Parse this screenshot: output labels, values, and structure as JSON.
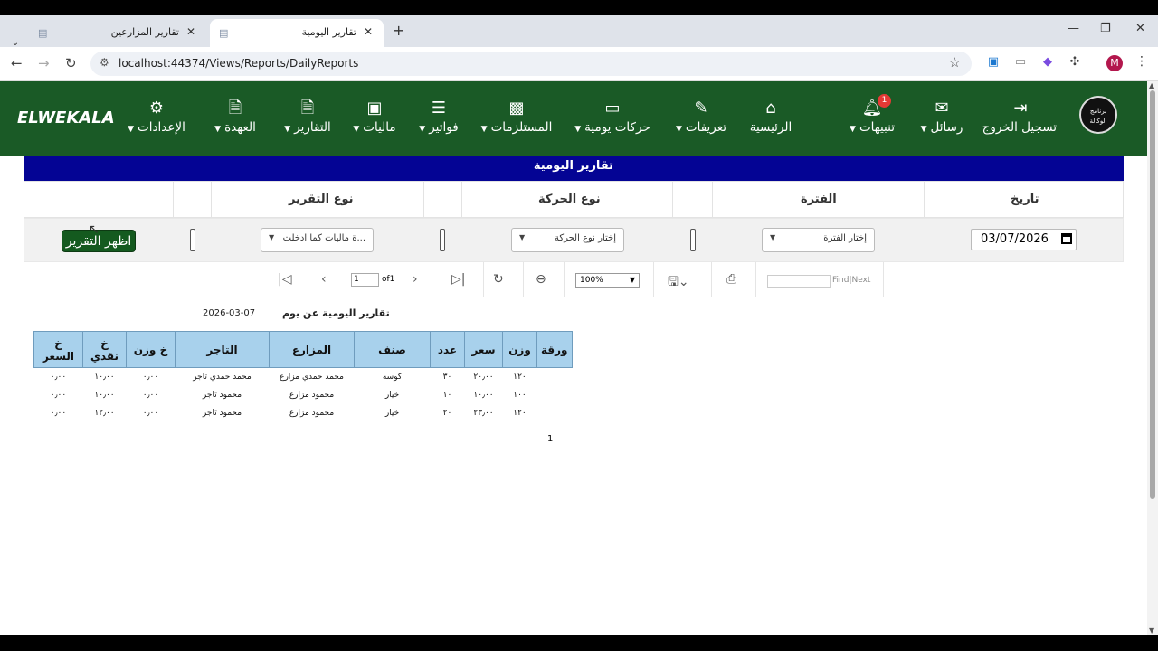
{
  "browser": {
    "tabs": [
      {
        "title": "تقارير المزارعين",
        "active": false
      },
      {
        "title": "تقارير اليومية",
        "active": true
      }
    ],
    "url": "localhost:44374/Views/Reports/DailyReports",
    "profile_initial": "M"
  },
  "navbar": {
    "logo": "ELWEKALA",
    "brand_text": "برنامج الوكالة",
    "items": [
      {
        "label": "تسجيل الخروج",
        "icon": "logout-icon",
        "caret": false
      },
      {
        "label": "رسائل",
        "icon": "envelope-icon",
        "caret": true
      },
      {
        "label": "تنبيهات",
        "icon": "bell-icon",
        "caret": true
      },
      {
        "label": "الرئيسية",
        "icon": "home-icon",
        "caret": false
      },
      {
        "label": "تعريفات",
        "icon": "edit-icon",
        "caret": true
      },
      {
        "label": "حركات يومية",
        "icon": "laptop-icon",
        "caret": true
      },
      {
        "label": "المستلزمات",
        "icon": "toolbox-icon",
        "caret": true
      },
      {
        "label": "فواتير",
        "icon": "list-icon",
        "caret": true
      },
      {
        "label": "ماليات",
        "icon": "money-icon",
        "caret": true
      },
      {
        "label": "التقارير",
        "icon": "document-icon",
        "caret": true
      },
      {
        "label": "العهدة",
        "icon": "file-icon",
        "caret": true
      },
      {
        "label": "الإعدادات",
        "icon": "gears-icon",
        "caret": true
      }
    ],
    "notifications_count": "1",
    "caret_glyph": "▼"
  },
  "report": {
    "title": "تقارير اليومية",
    "filters": {
      "date_label": "تاريخ",
      "period_label": "الفترة",
      "movement_label": "نوع الحركة",
      "report_type_label": "نوع التقرير",
      "date_value": "03/07/2026",
      "period_value": "إختار الفترة",
      "movement_value": "إختار نوع الحركة",
      "report_type_value": "...ة ماليات كما ادخلت",
      "show_button": "اظهر التقرير"
    },
    "viewer": {
      "page": "1",
      "of": "of1",
      "zoom": "100%",
      "find_next": "Find|Next"
    },
    "caption": "تقارير اليومية عن يوم",
    "caption_date": "2026-03-07",
    "columns": [
      "ورقة",
      "وزن",
      "سعر",
      "عدد",
      "صنف",
      "المزارع",
      "التاجر",
      "خ وزن",
      "خ نقدي",
      "خ السعر"
    ],
    "rows": [
      [
        "",
        "١٢٠",
        "٢٠٫٠٠",
        "٣٠",
        "كوسه",
        "محمد حمدي مزارع",
        "محمد حمدي تاجر",
        "٠٫٠٠",
        "١٠٫٠٠",
        "٠٫٠٠"
      ],
      [
        "",
        "١٠٠",
        "١٠٫٠٠",
        "١٠",
        "خيار",
        "محمود مزارع",
        "محمود تاجر",
        "٠٫٠٠",
        "١٠٫٠٠",
        "٠٫٠٠"
      ],
      [
        "",
        "١٢٠",
        "٢٣٫٠٠",
        "٢٠",
        "خيار",
        "محمود مزارع",
        "محمود تاجر",
        "٠٫٠٠",
        "١٢٫٠٠",
        "٠٫٠٠"
      ]
    ],
    "page_footer": "1"
  },
  "colors": {
    "navbar": "#1a5a26",
    "title_bar": "#040494",
    "table_header": "#a8d1ec",
    "button": "#145a1f"
  }
}
